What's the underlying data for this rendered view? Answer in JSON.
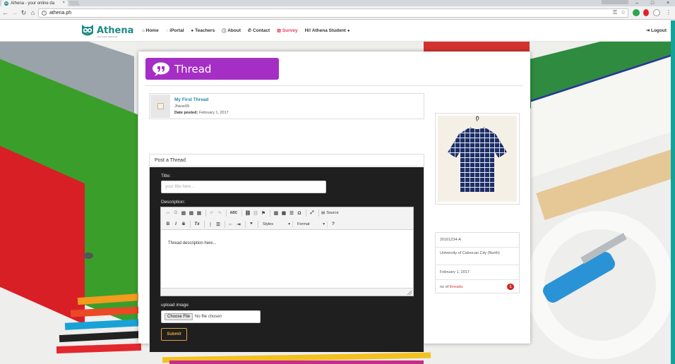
{
  "browser": {
    "tab_title": "Athena - your online da",
    "url": "athena.ph",
    "tab_close": "×",
    "win_minimize": "–",
    "win_maximize": "□",
    "win_close": "×"
  },
  "site": {
    "logo_text": "Athena",
    "logo_tagline": "Your online classmate",
    "nav": [
      {
        "icon": "home-icon",
        "glyph": "⌂",
        "label": "Home"
      },
      {
        "icon": "chat-icon",
        "glyph": "◌",
        "label": "iPortal"
      },
      {
        "icon": "user-icon",
        "glyph": "●",
        "label": "Teachers"
      },
      {
        "icon": "info-icon",
        "glyph": "ⓘ",
        "label": "About"
      },
      {
        "icon": "phone-icon",
        "glyph": "✆",
        "label": "Contact"
      },
      {
        "icon": "chart-icon",
        "glyph": "▥",
        "label": "Survey"
      },
      {
        "icon": "user-icon",
        "glyph": "●",
        "label": "Hi! Athena Student"
      }
    ],
    "logout_label": "Logout",
    "logout_glyph": "⇥",
    "colors": {
      "brand": "#1d8a84",
      "banner": "#a52fc4",
      "active_nav": "#e8365d",
      "submit": "#e9a53f",
      "badge": "#d1261f"
    }
  },
  "banner": {
    "title": "Thread"
  },
  "thread": {
    "title": "My First Thread",
    "author": "Jhane09",
    "date_label": "Date posted:",
    "date_value": "February 1, 2017"
  },
  "post_form": {
    "heading": "Post a Thread",
    "title_label": "Title:",
    "title_placeholder": "your title here...",
    "description_label": "Description:",
    "description_text": "Thread description here...",
    "toolbar_row1": [
      "✂",
      "⧉",
      "▤",
      "▤",
      "▤",
      "↶",
      "↷",
      "ABC",
      "⛓",
      "⛓",
      "⚑",
      "▨",
      "▦",
      "☰",
      "Ω",
      "⤢"
    ],
    "source_label": "Source",
    "toolbar_row2": [
      "B",
      "I",
      "S",
      "Tx",
      "⋮",
      "☰",
      "⇤",
      "⇥",
      "❞"
    ],
    "styles_label": "Styles",
    "format_label": "Format",
    "help_label": "?",
    "upload_label": "upload image",
    "choose_file_label": "Choose File",
    "no_file_text": "No file chosen",
    "submit_label": "Submit"
  },
  "profile": {
    "student_id": "20161234-A",
    "school": "University of Caloocan City (North)",
    "date": "February 1, 2017",
    "threads_prefix": "no of",
    "threads_word": "threads:",
    "threads_count": "1"
  }
}
